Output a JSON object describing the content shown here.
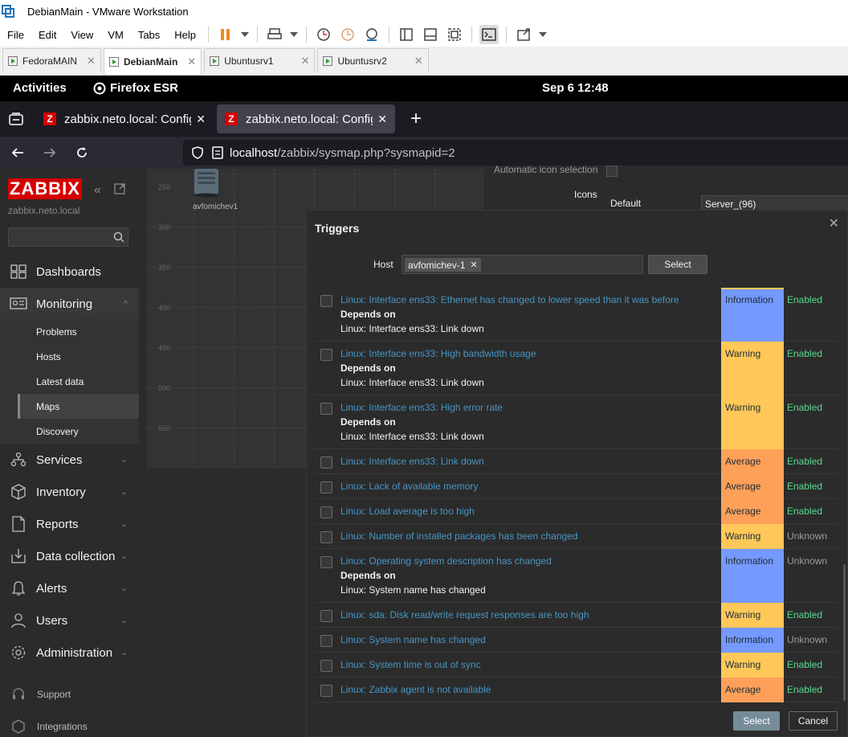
{
  "vmware": {
    "title": "DebianMain - VMware Workstation",
    "menu": [
      "File",
      "Edit",
      "View",
      "VM",
      "Tabs",
      "Help"
    ],
    "tabs": [
      {
        "label": "FedoraMAIN",
        "active": false
      },
      {
        "label": "DebianMain",
        "active": true
      },
      {
        "label": "Ubuntusrv1",
        "active": false
      },
      {
        "label": "Ubuntusrv2",
        "active": false
      }
    ]
  },
  "gnome": {
    "activities": "Activities",
    "app": "Firefox ESR",
    "clock": "Sep 6  12:48"
  },
  "firefox": {
    "tabs": [
      {
        "label": "zabbix.neto.local: Configuration of network maps",
        "icon": "Z"
      },
      {
        "label": "zabbix.neto.local: Configuration of network maps",
        "icon": "Z"
      }
    ],
    "url_host": "localhost",
    "url_path": "/zabbix/sysmap.php?sysmapid=2"
  },
  "sidebar": {
    "logo": "ZABBIX",
    "server": "zabbix.neto.local",
    "menu": [
      {
        "label": "Dashboards",
        "icon": "dashboards-icon"
      },
      {
        "label": "Monitoring",
        "icon": "monitoring-icon"
      },
      {
        "label": "Services",
        "icon": "services-icon"
      },
      {
        "label": "Inventory",
        "icon": "inventory-icon"
      },
      {
        "label": "Reports",
        "icon": "reports-icon"
      },
      {
        "label": "Data collection",
        "icon": "data-collection-icon"
      },
      {
        "label": "Alerts",
        "icon": "alerts-icon"
      },
      {
        "label": "Users",
        "icon": "users-icon"
      },
      {
        "label": "Administration",
        "icon": "administration-icon"
      }
    ],
    "monitoring_sub": [
      "Problems",
      "Hosts",
      "Latest data",
      "Maps",
      "Discovery"
    ],
    "bottom": [
      "Support",
      "Integrations"
    ]
  },
  "map": {
    "y_ticks": [
      "250",
      "300",
      "350",
      "400",
      "450",
      "500",
      "550"
    ],
    "element_label": "avfomichev1",
    "props_label": "Icons",
    "props_partial": "Automatic icon selection",
    "icon_default_label": "Default",
    "icon_default_value": "Server_(96)"
  },
  "modal": {
    "title": "Triggers",
    "host_label": "Host",
    "host_tag": "avfomichev-1",
    "select_button": "Select",
    "ok_button": "Select",
    "cancel_button": "Cancel",
    "rows": [
      {
        "name": "Linux: Interface ens33: Ethernet has changed to lower speed than it was before",
        "depends": "Depends on",
        "dep": "Linux: Interface ens33: Link down",
        "severity": "Information",
        "status": "Enabled"
      },
      {
        "name": "Linux: Interface ens33: High bandwidth usage",
        "depends": "Depends on",
        "dep": "Linux: Interface ens33: Link down",
        "severity": "Warning",
        "status": "Enabled"
      },
      {
        "name": "Linux: Interface ens33: High error rate",
        "depends": "Depends on",
        "dep": "Linux: Interface ens33: Link down",
        "severity": "Warning",
        "status": "Enabled"
      },
      {
        "name": "Linux: Interface ens33: Link down",
        "depends": "",
        "dep": "",
        "severity": "Average",
        "status": "Enabled"
      },
      {
        "name": "Linux: Lack of available memory",
        "depends": "",
        "dep": "",
        "severity": "Average",
        "status": "Enabled"
      },
      {
        "name": "Linux: Load average is too high",
        "depends": "",
        "dep": "",
        "severity": "Average",
        "status": "Enabled"
      },
      {
        "name": "Linux: Number of installed packages has been changed",
        "depends": "",
        "dep": "",
        "severity": "Warning",
        "status": "Unknown"
      },
      {
        "name": "Linux: Operating system description has changed",
        "depends": "Depends on",
        "dep": "Linux: System name has changed",
        "severity": "Information",
        "status": "Unknown"
      },
      {
        "name": "Linux: sda: Disk read/write request responses are too high",
        "depends": "",
        "dep": "",
        "severity": "Warning",
        "status": "Enabled"
      },
      {
        "name": "Linux: System name has changed",
        "depends": "",
        "dep": "",
        "severity": "Information",
        "status": "Unknown"
      },
      {
        "name": "Linux: System time is out of sync",
        "depends": "",
        "dep": "",
        "severity": "Warning",
        "status": "Enabled"
      },
      {
        "name": "Linux: Zabbix agent is not available",
        "depends": "",
        "dep": "",
        "severity": "Average",
        "status": "Enabled"
      }
    ]
  },
  "colors": {
    "Information": "#7499ff",
    "Warning": "#ffc859",
    "Average": "#ffa059",
    "Enabled": "#59db8f",
    "Unknown": "#9b9b9b",
    "link": "#4796c4"
  }
}
